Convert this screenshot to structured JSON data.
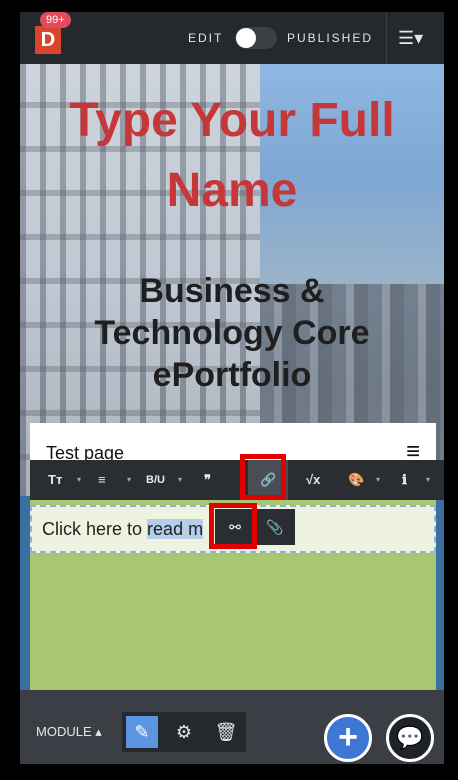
{
  "topbar": {
    "logo_letter": "D",
    "notification_count": "99+",
    "edit_label": "EDIT",
    "published_label": "PUBLISHED",
    "menu_icon": "☰▾"
  },
  "hero": {
    "name_line1": "Type Your Full",
    "name_line2": "Name",
    "subtitle_line1": "Business &",
    "subtitle_line2": "Technology Core",
    "subtitle_line3": "ePortfolio"
  },
  "page_header": {
    "title": "Test page",
    "menu_icon": "≡"
  },
  "toolbar": {
    "text_size": "Tт",
    "list": "≡",
    "format": "B/U",
    "quote": "❞",
    "attach": "🔗",
    "math": "√x",
    "paint": "🎨",
    "info": "ℹ",
    "caret": "▾"
  },
  "content": {
    "text_before": "Click here to ",
    "text_selected": "read m",
    "popup_link_icon": "⚯",
    "popup_attach_icon": "📎"
  },
  "bottombar": {
    "module_label": "MODULE ▴",
    "edit_icon": "✎",
    "settings_icon": "⚙",
    "delete_icon": "🗑",
    "add_icon": "+",
    "chat_icon": "💬"
  },
  "colors": {
    "title_red": "#c6373a",
    "accent_blue": "#3d77d3",
    "content_green": "#a7c770",
    "highlight_red": "#e00000"
  }
}
